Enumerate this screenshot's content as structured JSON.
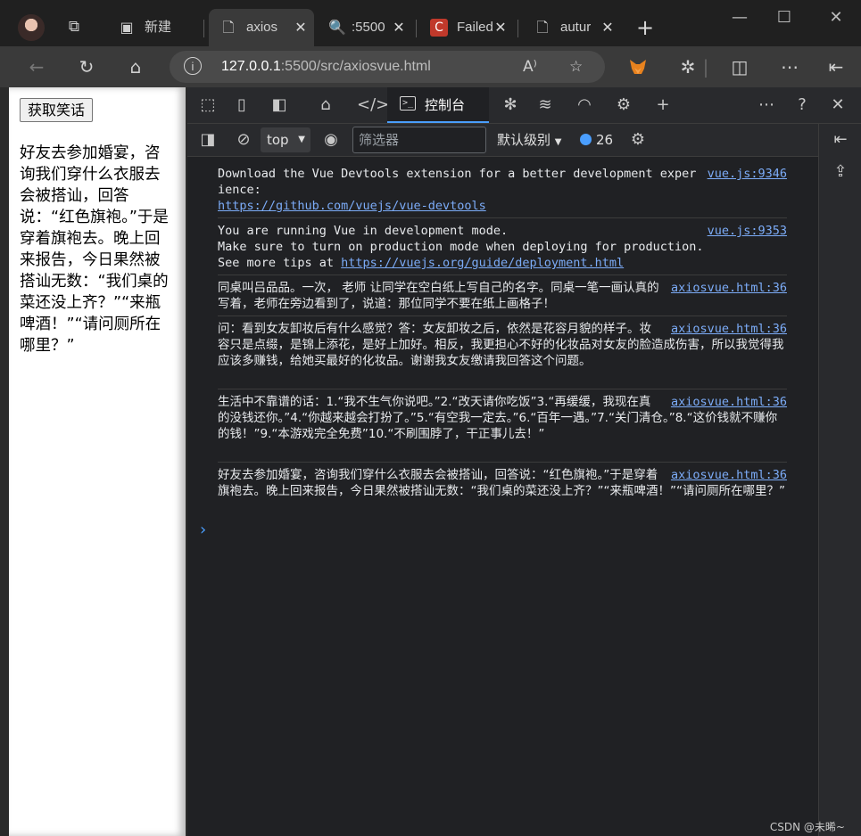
{
  "browser": {
    "tabs": [
      {
        "icon": "file-icon",
        "label": "新建"
      },
      {
        "icon": "file-icon",
        "label": "axios"
      },
      {
        "icon": "search-icon",
        "label": ":5500"
      },
      {
        "icon": "c-logo-icon",
        "label": "Failed"
      },
      {
        "icon": "file-icon",
        "label": "autur"
      }
    ],
    "url_host": "127.0.0.1",
    "url_path": ":5500/src/axiosvue.html"
  },
  "page": {
    "button_label": "获取笑话",
    "joke_text": "好友去参加婚宴，咨询我们穿什么衣服去会被搭讪，回答说：“红色旗袍。”于是穿着旗袍去。晚上回来报告，今日果然被搭讪无数：“我们桌的菜还没上齐？”“来瓶啤酒！”“请问厕所在哪里？”"
  },
  "devtools": {
    "console_tab_label": "控制台",
    "context": "top",
    "filter_placeholder": "筛选器",
    "level_label": "默认级别",
    "issues_count": "26",
    "messages": [
      {
        "source": "vue.js:9346",
        "text": "Download the Vue Devtools extension for a better development experience:",
        "link": "https://github.com/vuejs/vue-devtools"
      },
      {
        "source": "vue.js:9353",
        "text": "You are running Vue in development mode.\nMake sure to turn on production mode when deploying for production.\nSee more tips at ",
        "link": "https://vuejs.org/guide/deployment.html"
      },
      {
        "source": "axiosvue.html:36",
        "text": "同桌叫吕品品。一次， 老师 让同学在空白纸上写自己的名字。同桌一笔一画认真的写着，老师在旁边看到了，说道：那位同学不要在纸上画格子！"
      },
      {
        "source": "axiosvue.html:36",
        "text": "问：看到女友卸妆后有什么感觉？答：女友卸妆之后，依然是花容月貌的样子。妆容只是点缀，是锦上添花，是好上加好。相反，我更担心不好的化妆品对女友的脸造成伤害，所以我觉得我应该多赚钱，给她买最好的化妆品。谢谢我女友缴请我回答这个问题。"
      },
      {
        "source": "axiosvue.html:36",
        "text": "生活中不靠谱的话：1.“我不生气你说吧。”2.“改天请你吃饭”3.“再缓缓，我现在真的没钱还你。”4.“你越来越会打扮了。”5.“有空我一定去。”6.“百年一遇。”7.“关门清仓。”8.“这价钱就不赚你的钱！”9.“本游戏完全免费”10.“不刷围脖了，干正事儿去！”"
      },
      {
        "source": "axiosvue.html:36",
        "text": "好友去参加婚宴，咨询我们穿什么衣服去会被搭讪，回答说：“红色旗袍。”于是穿着旗袍去。晚上回来报告，今日果然被搭讪无数：“我们桌的菜还没上齐？”“来瓶啤酒！”“请问厕所在哪里？”"
      }
    ]
  },
  "watermark": "CSDN @未晞~"
}
